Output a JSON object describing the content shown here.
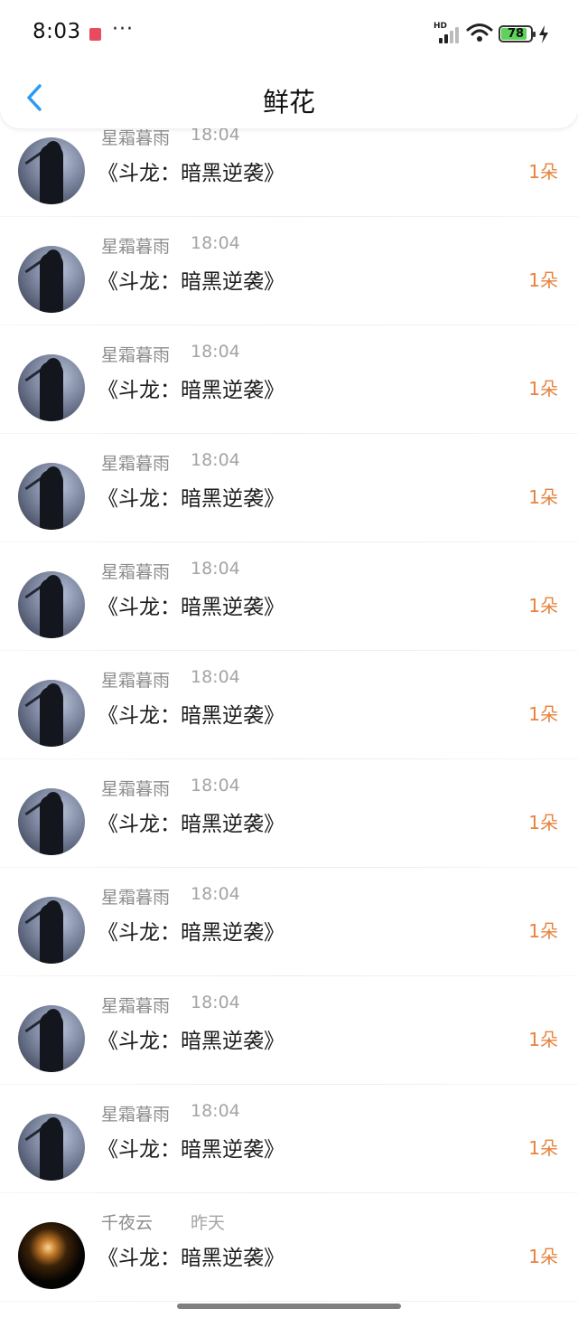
{
  "status_bar": {
    "time": "8:03",
    "more": "···",
    "network_label": "HD",
    "battery_level": "78",
    "notification_color": "#e84a5f",
    "battery_color": "#5fd15a"
  },
  "header": {
    "title": "鲜花",
    "back_icon": "chevron-left-icon",
    "accent_color": "#2b9af3"
  },
  "list": {
    "count_color": "#e8823d",
    "items": [
      {
        "user": "星霜暮雨",
        "time": "18:04",
        "book": "《斗龙：暗黑逆袭》",
        "count": "1朵",
        "avatar": "silhouette-avatar"
      },
      {
        "user": "星霜暮雨",
        "time": "18:04",
        "book": "《斗龙：暗黑逆袭》",
        "count": "1朵",
        "avatar": "silhouette-avatar"
      },
      {
        "user": "星霜暮雨",
        "time": "18:04",
        "book": "《斗龙：暗黑逆袭》",
        "count": "1朵",
        "avatar": "silhouette-avatar"
      },
      {
        "user": "星霜暮雨",
        "time": "18:04",
        "book": "《斗龙：暗黑逆袭》",
        "count": "1朵",
        "avatar": "silhouette-avatar"
      },
      {
        "user": "星霜暮雨",
        "time": "18:04",
        "book": "《斗龙：暗黑逆袭》",
        "count": "1朵",
        "avatar": "silhouette-avatar"
      },
      {
        "user": "星霜暮雨",
        "time": "18:04",
        "book": "《斗龙：暗黑逆袭》",
        "count": "1朵",
        "avatar": "silhouette-avatar"
      },
      {
        "user": "星霜暮雨",
        "time": "18:04",
        "book": "《斗龙：暗黑逆袭》",
        "count": "1朵",
        "avatar": "silhouette-avatar"
      },
      {
        "user": "星霜暮雨",
        "time": "18:04",
        "book": "《斗龙：暗黑逆袭》",
        "count": "1朵",
        "avatar": "silhouette-avatar"
      },
      {
        "user": "星霜暮雨",
        "time": "18:04",
        "book": "《斗龙：暗黑逆袭》",
        "count": "1朵",
        "avatar": "silhouette-avatar"
      },
      {
        "user": "星霜暮雨",
        "time": "18:04",
        "book": "《斗龙：暗黑逆袭》",
        "count": "1朵",
        "avatar": "silhouette-avatar"
      },
      {
        "user": "千夜云",
        "time": "昨天",
        "book": "《斗龙：暗黑逆袭》",
        "count": "1朵",
        "avatar": "glow-avatar"
      }
    ]
  }
}
